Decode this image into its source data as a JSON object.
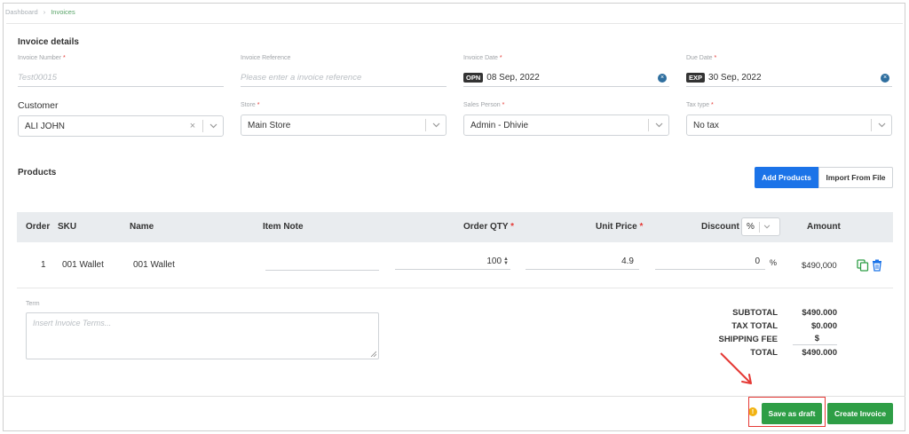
{
  "breadcrumb": {
    "home": "Dashboard",
    "current": "Invoices"
  },
  "invoice_details": {
    "title": "Invoice details",
    "invoice_number": {
      "label": "Invoice Number",
      "placeholder": "Test00015"
    },
    "invoice_reference": {
      "label": "Invoice Reference",
      "placeholder": "Please enter a invoice reference"
    },
    "invoice_date": {
      "label": "Invoice Date",
      "badge": "OPN",
      "value": "08 Sep, 2022"
    },
    "due_date": {
      "label": "Due Date",
      "badge": "EXP",
      "value": "30 Sep, 2022"
    },
    "customer": {
      "label": "Customer",
      "value": "ALI JOHN"
    },
    "store": {
      "label": "Store",
      "value": "Main Store"
    },
    "sales_person": {
      "label": "Sales Person",
      "value": "Admin - Dhivie"
    },
    "tax_type": {
      "label": "Tax type",
      "value": "No tax"
    },
    "required_mark": "*"
  },
  "products": {
    "title": "Products",
    "add_button": "Add Products",
    "import_button": "Import From File",
    "columns": {
      "order": "Order",
      "sku": "SKU",
      "name": "Name",
      "item_note": "Item Note",
      "order_qty": "Order QTY",
      "unit_price": "Unit Price",
      "discount": "Discount",
      "discount_type": "%",
      "amount": "Amount"
    },
    "rows": [
      {
        "order": "1",
        "sku": "001 Wallet",
        "name": "001 Wallet",
        "item_note": "",
        "qty": "100",
        "unit_price": "4.9",
        "discount": "0",
        "discount_unit": "%",
        "amount": "$490,000"
      }
    ]
  },
  "term": {
    "label": "Term",
    "placeholder": "Insert Invoice Terms..."
  },
  "totals": {
    "subtotal_label": "SUBTOTAL",
    "subtotal": "$490.000",
    "tax_label": "TAX TOTAL",
    "tax": "$0.000",
    "shipping_label": "SHIPPING FEE",
    "shipping": "$",
    "total_label": "TOTAL",
    "total": "$490.000"
  },
  "footer": {
    "save_draft": "Save as draft",
    "create_invoice": "Create Invoice"
  },
  "colors": {
    "primary": "#1b73e8",
    "success": "#2e9e46",
    "annotation": "#e53935",
    "badge": "#333333"
  }
}
